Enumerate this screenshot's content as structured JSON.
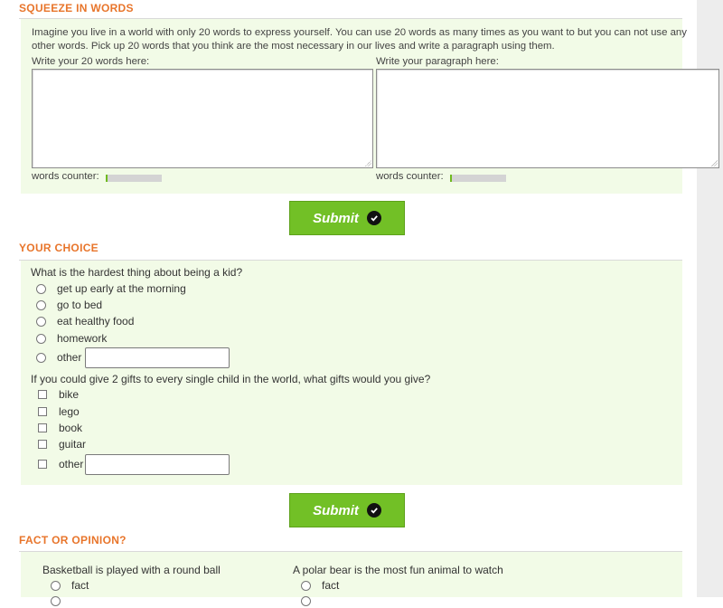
{
  "squeeze": {
    "title": "SQUEEZE IN WORDS",
    "intro": "Imagine you live in a world with only 20 words to express yourself. You can use 20 words as many times as you want to but you can not use any other words. Pick up 20 words that you think are the most necessary in our lives and write a paragraph using them.",
    "words_label": "Write your 20 words here:",
    "paragraph_label": "Write your paragraph here:",
    "words_value": "",
    "paragraph_value": "",
    "counter_label": "words counter:",
    "submit_label": "Submit"
  },
  "choice": {
    "title": "YOUR CHOICE",
    "q1": "What is the hardest thing about being a kid?",
    "q1_options": [
      "get up early at the morning",
      "go to bed",
      "eat healthy food",
      "homework",
      "other"
    ],
    "q1_other_value": "",
    "q2": "If you could give 2 gifts to every single child in the world, what gifts would you give?",
    "q2_options": [
      "bike",
      "lego",
      "book",
      "guitar",
      "other"
    ],
    "q2_other_value": "",
    "submit_label": "Submit"
  },
  "fact": {
    "title": "FACT OR OPINION?",
    "statements": [
      {
        "text": "Basketball is played with a round ball",
        "option": "fact"
      },
      {
        "text": "A polar bear is the most fun animal to watch",
        "option": "fact"
      }
    ]
  },
  "icons": {
    "submit": "check-circle-icon"
  },
  "colors": {
    "accent": "#e8752b",
    "button": "#72c026",
    "panel": "#f2fbe7"
  }
}
